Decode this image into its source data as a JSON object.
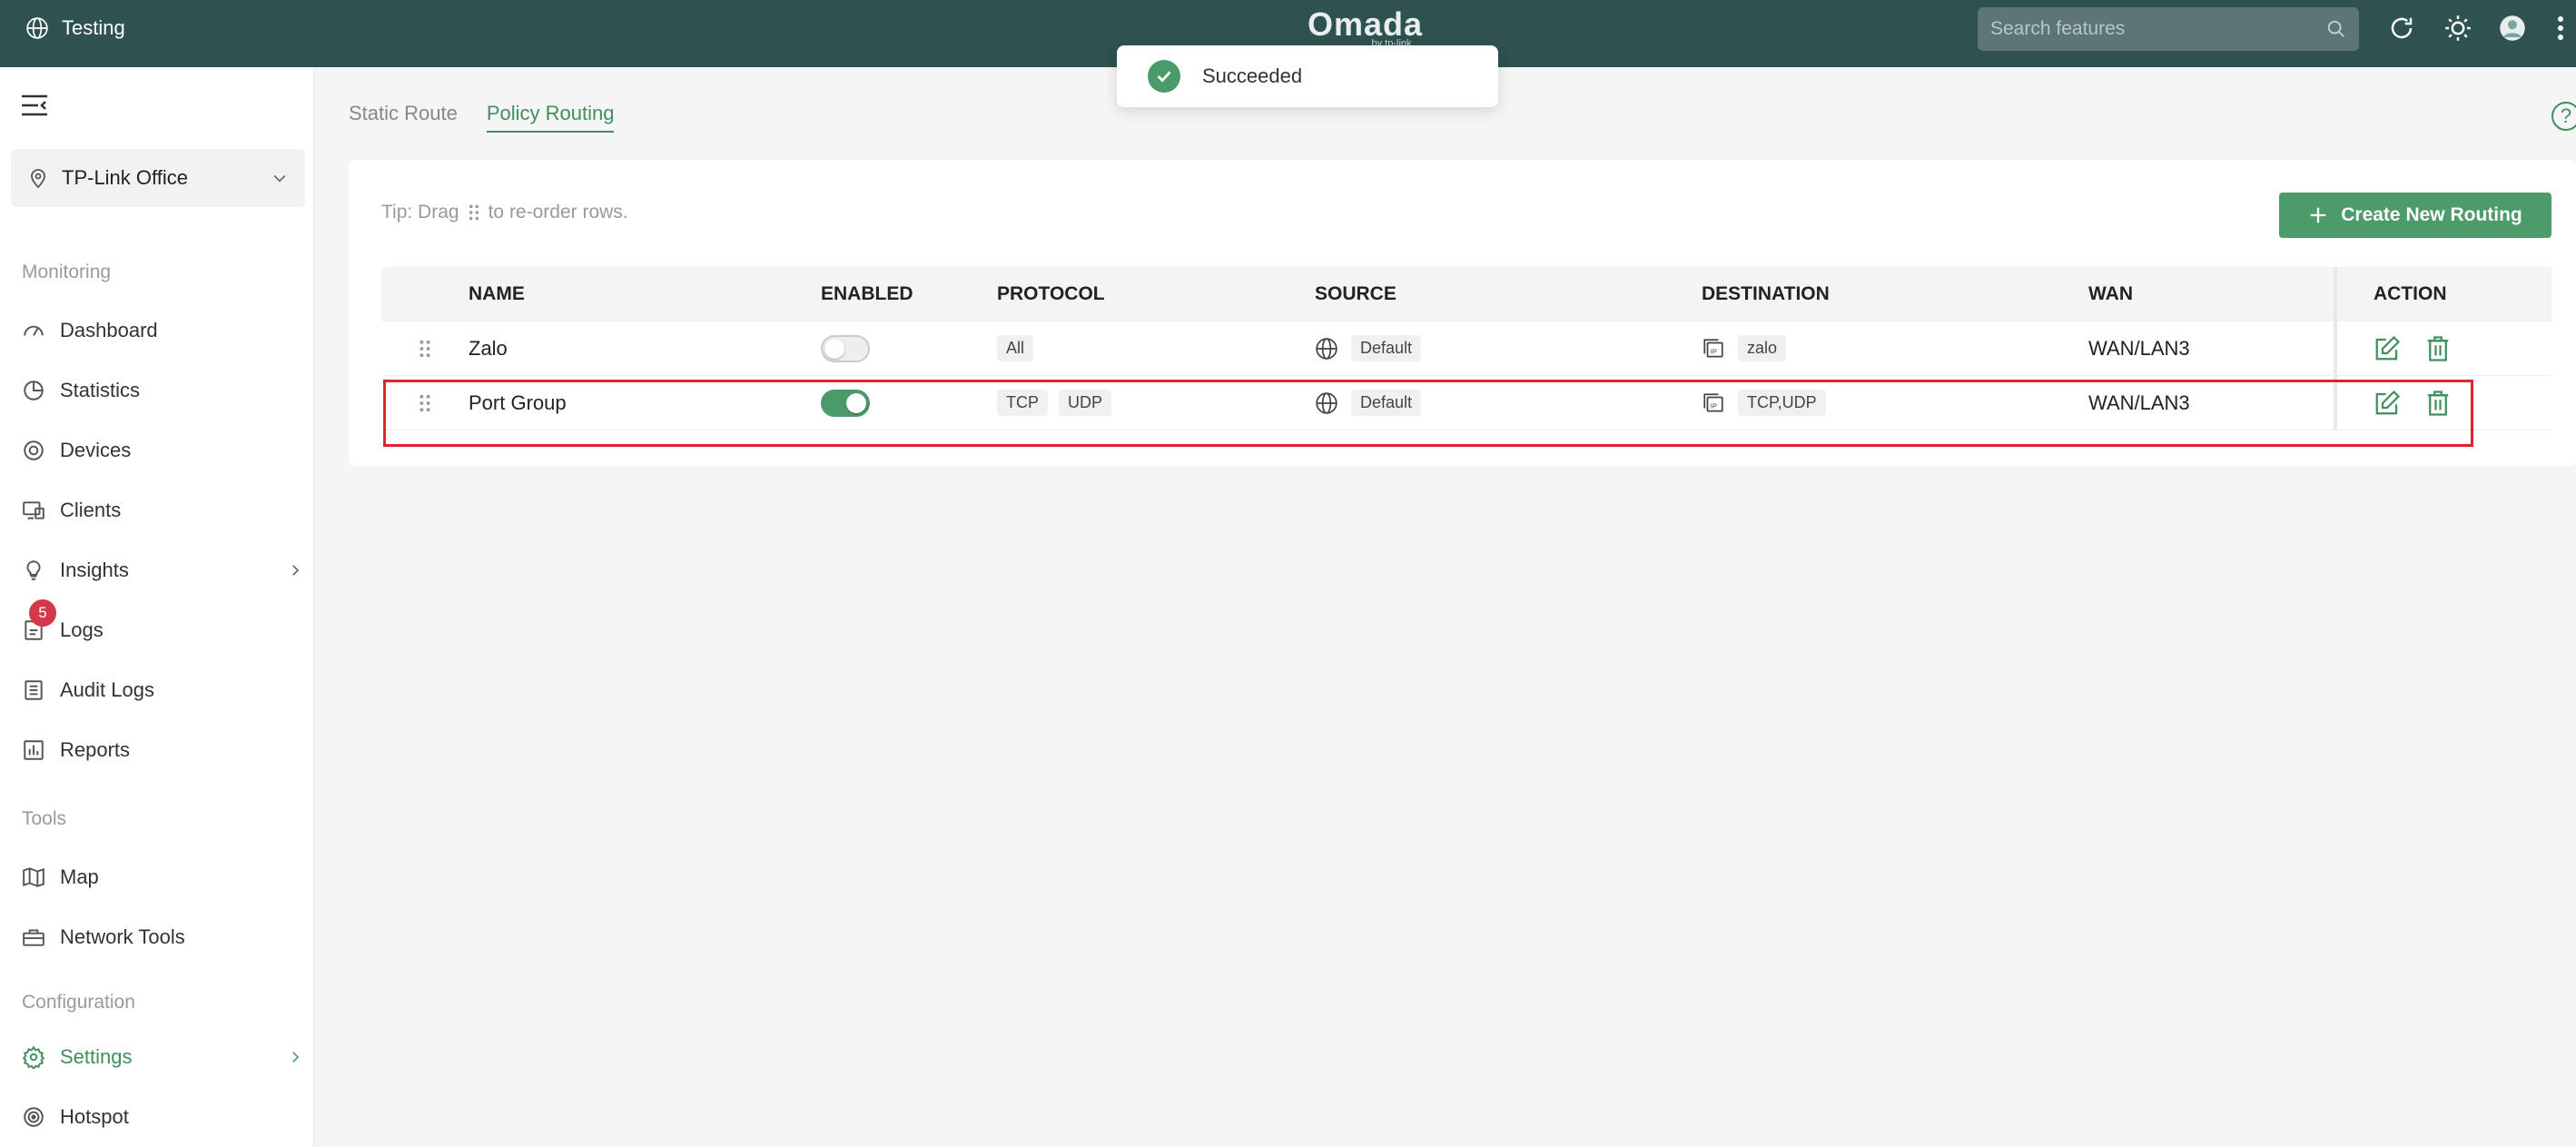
{
  "header": {
    "site_name": "Testing",
    "brand": "Omada",
    "brand_sub": "by tp-link",
    "search_placeholder": "Search features"
  },
  "toast": {
    "message": "Succeeded"
  },
  "sidebar": {
    "site_selector": "TP-Link Office",
    "sections": {
      "monitoring": "Monitoring",
      "tools": "Tools",
      "configuration": "Configuration"
    },
    "items": [
      {
        "label": "Dashboard",
        "icon": "dashboard-icon"
      },
      {
        "label": "Statistics",
        "icon": "pie-chart-icon"
      },
      {
        "label": "Devices",
        "icon": "devices-icon"
      },
      {
        "label": "Clients",
        "icon": "clients-icon"
      },
      {
        "label": "Insights",
        "icon": "lightbulb-icon"
      },
      {
        "label": "Logs",
        "icon": "logs-icon",
        "badge": "5"
      },
      {
        "label": "Audit Logs",
        "icon": "audit-logs-icon"
      },
      {
        "label": "Reports",
        "icon": "reports-icon"
      },
      {
        "label": "Map",
        "icon": "map-icon"
      },
      {
        "label": "Network Tools",
        "icon": "toolbox-icon"
      },
      {
        "label": "Settings",
        "icon": "gear-icon"
      },
      {
        "label": "Hotspot",
        "icon": "hotspot-icon"
      }
    ]
  },
  "tabs": [
    {
      "label": "Static Route",
      "active": false
    },
    {
      "label": "Policy Routing",
      "active": true
    }
  ],
  "content": {
    "tip_prefix": "Tip: Drag",
    "tip_suffix": "to re-order rows.",
    "create_button": "Create New Routing",
    "columns": [
      "NAME",
      "ENABLED",
      "PROTOCOL",
      "SOURCE",
      "DESTINATION",
      "WAN",
      "ACTION"
    ],
    "rows": [
      {
        "name": "Zalo",
        "enabled": false,
        "protocols": [
          "All"
        ],
        "source": "Default",
        "destination": "zalo",
        "wan": "WAN/LAN3"
      },
      {
        "name": "Port Group",
        "enabled": true,
        "protocols": [
          "TCP",
          "UDP"
        ],
        "source": "Default",
        "destination": "TCP,UDP",
        "wan": "WAN/LAN3"
      }
    ]
  },
  "colors": {
    "topbar": "#2e5250",
    "accent": "#3f8f5f",
    "button": "#4d9a6a",
    "badge": "#d6384b",
    "highlight": "#e0242f"
  }
}
